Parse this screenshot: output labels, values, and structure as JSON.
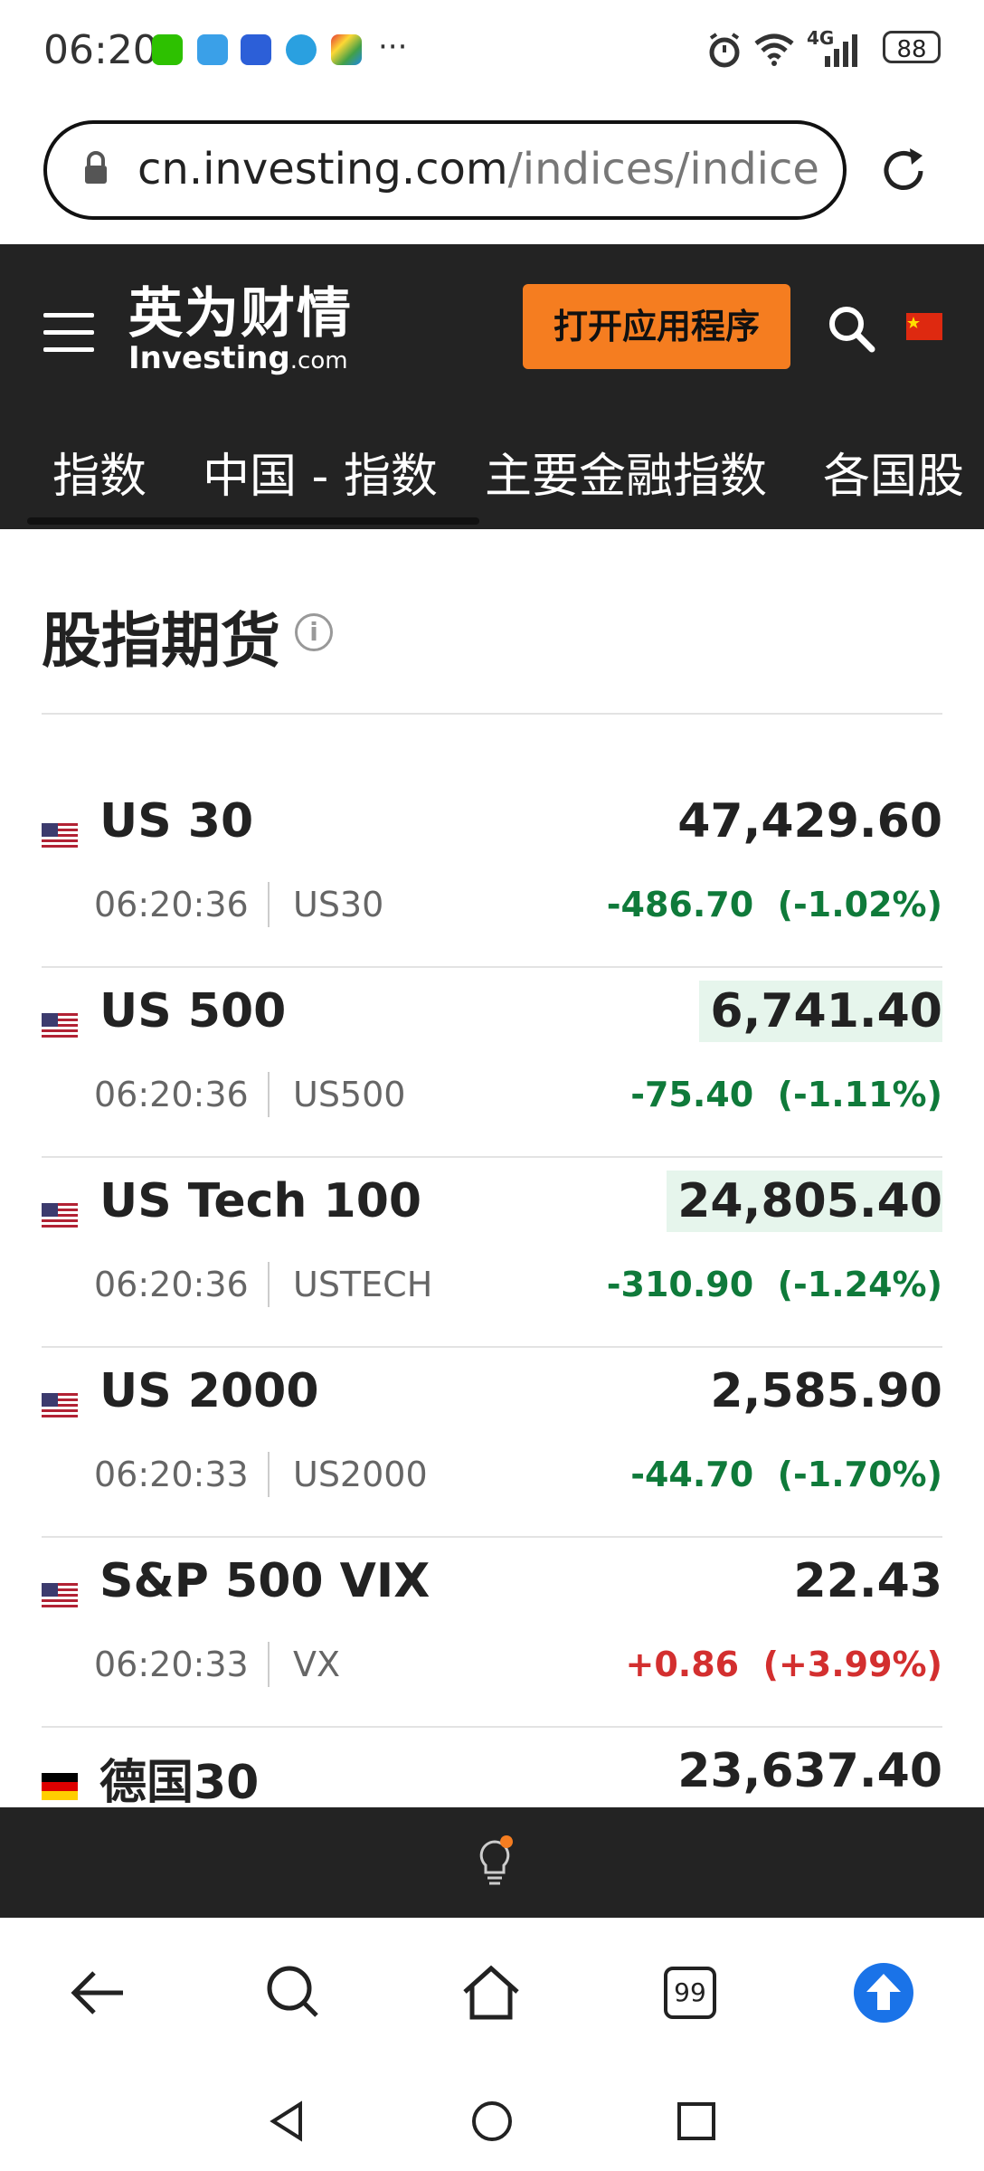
{
  "status_bar": {
    "time": "06:20",
    "more": "···",
    "network": "4G",
    "battery": "88"
  },
  "url_bar": {
    "host": "cn.investing.com",
    "path": "/indices/indices"
  },
  "header": {
    "logo_cn": "英为财情",
    "logo_en": "Investing",
    "logo_en_suffix": ".com",
    "open_app": "打开应用程序",
    "nav_tabs": [
      "指数",
      "中国 - 指数",
      "主要金融指数",
      "各国股"
    ]
  },
  "section": {
    "title": "股指期货",
    "info": "i"
  },
  "rows": [
    {
      "name": "US 30",
      "time": "06:20:36",
      "symbol": "US30",
      "price": "47,429.60",
      "change": "-486.70",
      "change_pct": "(-1.02%)"
    },
    {
      "name": "US 500",
      "time": "06:20:36",
      "symbol": "US500",
      "price": "6,741.40",
      "change": "-75.40",
      "change_pct": "(-1.11%)"
    },
    {
      "name": "US Tech 100",
      "time": "06:20:36",
      "symbol": "USTECH",
      "price": "24,805.40",
      "change": "-310.90",
      "change_pct": "(-1.24%)"
    },
    {
      "name": "US 2000",
      "time": "06:20:33",
      "symbol": "US2000",
      "price": "2,585.90",
      "change": "-44.70",
      "change_pct": "(-1.70%)"
    },
    {
      "name": "S&P 500 VIX",
      "time": "06:20:33",
      "symbol": "VX",
      "price": "22.43",
      "change": "+0.86",
      "change_pct": "(+3.99%)"
    },
    {
      "name": "德国30",
      "price": "23,637.40"
    }
  ],
  "browser_nav": {
    "tabs_count": "99"
  },
  "colors": {
    "negative": "#0f7a3a",
    "positive": "#d32f2f",
    "accent": "#f57d20",
    "header_bg": "#232323",
    "scroll_up_button": "#1a73e8"
  }
}
